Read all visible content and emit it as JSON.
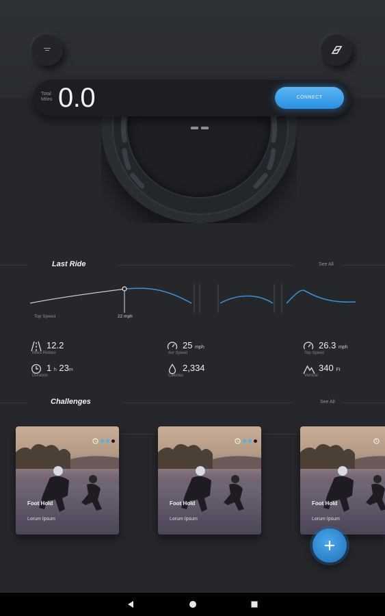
{
  "header": {
    "menu_icon": "menu-lines-icon",
    "brand_icon": "brand-logo-icon"
  },
  "miles": {
    "label": "Total Miles",
    "value": "0.0",
    "connect_label": "CONNECT"
  },
  "last_ride": {
    "title": "Last Ride",
    "see_all": "See All",
    "chart_left_label": "Top Speed",
    "chart_marker_label": "22 mph",
    "stats": [
      {
        "icon": "road-icon",
        "value": "12.2",
        "unit": "",
        "label": "Miles Ridden"
      },
      {
        "icon": "speedometer-icon",
        "value": "25",
        "unit": "mph",
        "label": "Avr Speed"
      },
      {
        "icon": "speedometer-icon",
        "value": "26.3",
        "unit": "mph",
        "label": "Top Speed"
      },
      {
        "icon": "clock-icon",
        "value_parts": [
          "1",
          "h",
          "23",
          "m"
        ],
        "label": "Duration"
      },
      {
        "icon": "drop-icon",
        "value": "2,334",
        "unit": "",
        "label": "Calories"
      },
      {
        "icon": "mountain-icon",
        "value": "340",
        "unit": "Ft",
        "label": "Vertical"
      }
    ]
  },
  "challenges": {
    "title": "Challenges",
    "see_all": "See All",
    "cards": [
      {
        "title": "Foot Hold",
        "subtitle": "Lorum Ipsum"
      },
      {
        "title": "Foot Hold",
        "subtitle": "Lorum Ipsum"
      },
      {
        "title": "Foot Hold",
        "subtitle": "Lorum Ipsum"
      }
    ],
    "badge_colors": [
      "#4fb0ea",
      "#4fb0ea",
      "#1a1a1a"
    ]
  },
  "fab": {
    "icon": "plus-icon"
  },
  "nav": {
    "back": "back-icon",
    "home": "home-icon",
    "recents": "recents-icon"
  }
}
